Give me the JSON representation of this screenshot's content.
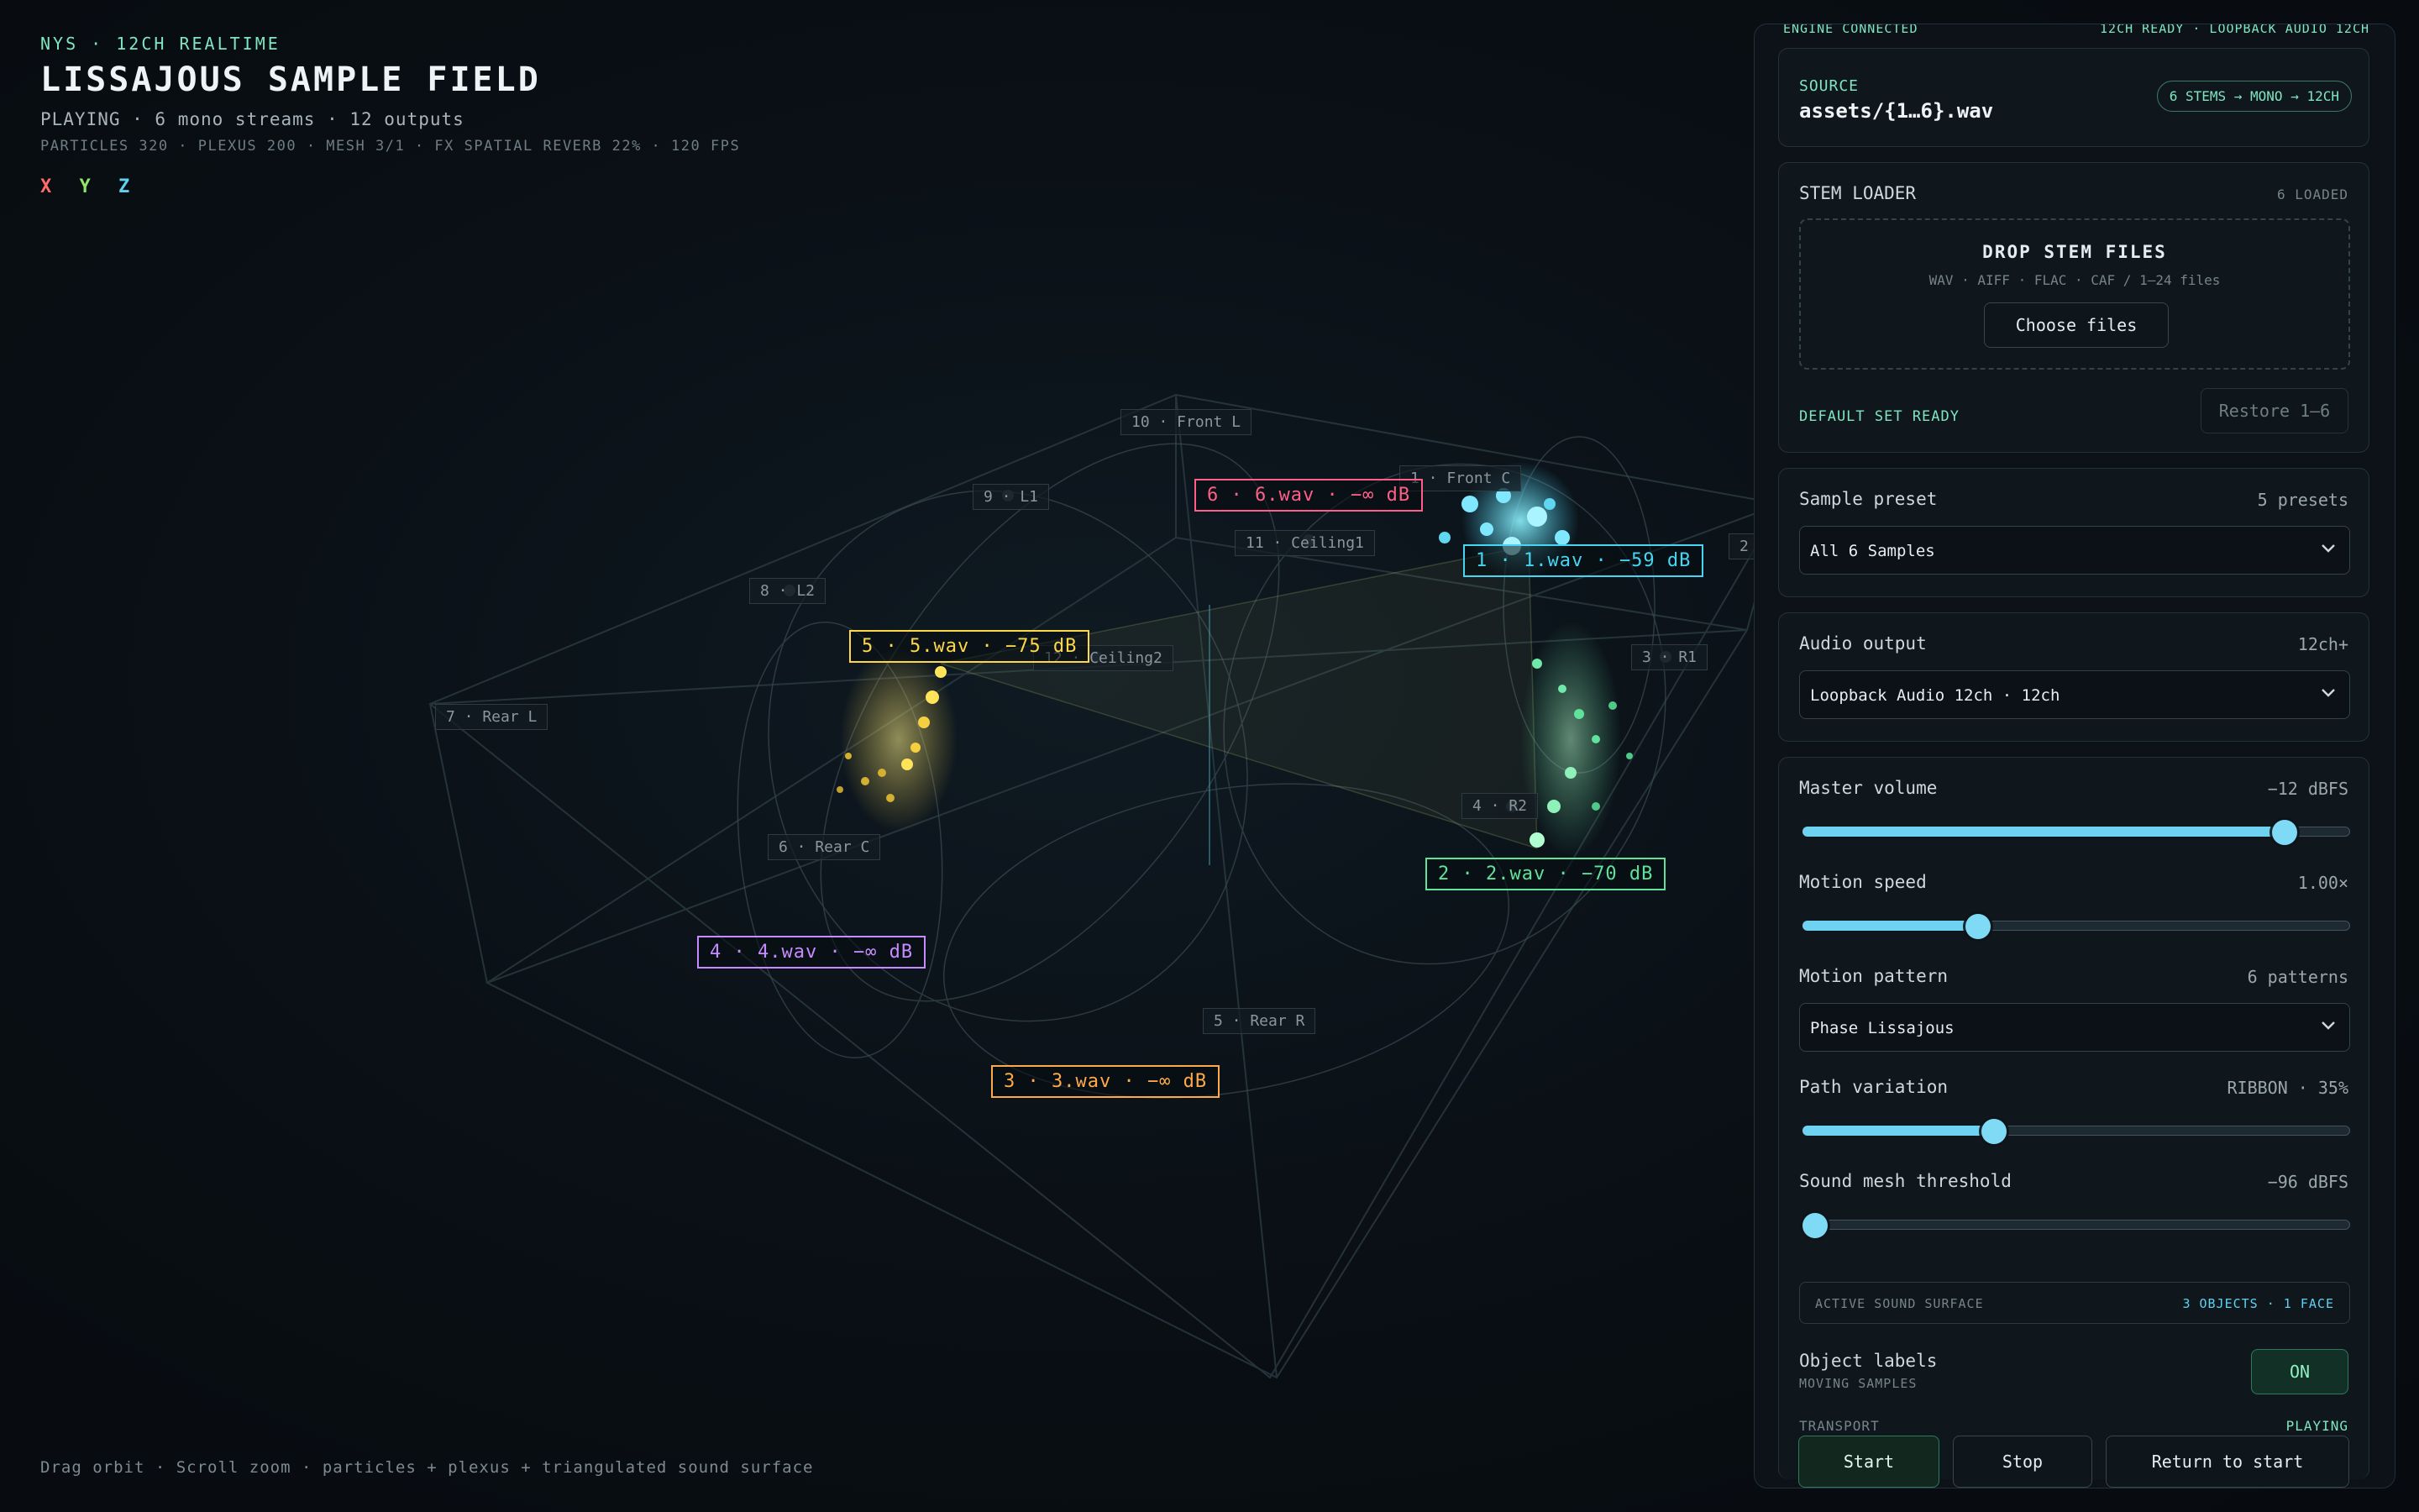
{
  "hud": {
    "kicker": "NYS · 12CH REALTIME",
    "title": "LISSAJOUS SAMPLE FIELD",
    "status": "PLAYING · 6 mono streams · 12 outputs",
    "stats": "PARTICLES 320 · PLEXUS 200 · MESH 3/1 · FX SPATIAL REVERB 22% · 120 FPS",
    "axes": [
      {
        "label": "X",
        "color": "#ff6b6b"
      },
      {
        "label": "Y",
        "color": "#8ee66b"
      },
      {
        "label": "Z",
        "color": "#5fd2f0"
      }
    ],
    "hint": "Drag orbit · Scroll zoom · particles + plexus + triangulated sound surface"
  },
  "speakers": [
    {
      "label": "10 · Front L"
    },
    {
      "label": "1 · Front C"
    },
    {
      "label": "9 · L1"
    },
    {
      "label": "11 · Ceiling1"
    },
    {
      "label": "8 · L2"
    },
    {
      "label": "12 · Ceiling2"
    },
    {
      "label": "7 · Rear L"
    },
    {
      "label": "3 · R1"
    },
    {
      "label": "4 · R2"
    },
    {
      "label": "6 · Rear C"
    },
    {
      "label": "5 · Rear R"
    },
    {
      "label": "2"
    }
  ],
  "objects": [
    {
      "label": "6 · 6.wav · −∞ dB",
      "color": "#ff5f86"
    },
    {
      "label": "1 · 1.wav · −59 dB",
      "color": "#46d6f2"
    },
    {
      "label": "5 · 5.wav · −75 dB",
      "color": "#ffd84a"
    },
    {
      "label": "2 · 2.wav · −70 dB",
      "color": "#5fe39a"
    },
    {
      "label": "4 · 4.wav · −∞ dB",
      "color": "#c68cff"
    },
    {
      "label": "3 · 3.wav · −∞ dB",
      "color": "#ffaa4a"
    }
  ],
  "panel": {
    "peek_left": "ENGINE CONNECTED",
    "peek_right": "12CH READY · LOOPBACK AUDIO 12CH",
    "source": {
      "label": "SOURCE",
      "path": "assets/{1…6}.wav",
      "badge": "6 STEMS → MONO → 12CH"
    },
    "stem_loader": {
      "title": "STEM LOADER",
      "count": "6 LOADED",
      "drop_title": "DROP STEM FILES",
      "formats": "WAV · AIFF · FLAC · CAF / 1–24 files",
      "choose": "Choose files",
      "ready": "DEFAULT SET READY",
      "restore": "Restore 1–6"
    },
    "preset": {
      "label": "Sample preset",
      "count": "5 presets",
      "selected": "All 6 Samples"
    },
    "output": {
      "label": "Audio output",
      "count": "12ch+",
      "selected": "Loopback Audio 12ch · 12ch"
    },
    "master_volume": {
      "label": "Master volume",
      "value": "−12 dBFS",
      "level": 0.88
    },
    "motion_speed": {
      "label": "Motion speed",
      "value": "1.00×",
      "level": 0.32
    },
    "motion_pattern": {
      "label": "Motion pattern",
      "count": "6 patterns",
      "selected": "Phase Lissajous"
    },
    "path_variation": {
      "label": "Path variation",
      "value": "RIBBON · 35%",
      "level": 0.35
    },
    "mesh_threshold": {
      "label": "Sound mesh threshold",
      "value": "−96 dBFS",
      "level": 0.0
    },
    "surface": {
      "label": "ACTIVE SOUND SURFACE",
      "value": "3 OBJECTS · 1 FACE"
    },
    "object_labels": {
      "label": "Object labels",
      "sub": "MOVING SAMPLES",
      "toggle": "ON"
    },
    "transport": {
      "label": "TRANSPORT",
      "state": "PLAYING",
      "start": "Start",
      "stop": "Stop",
      "rewind": "Return to start"
    }
  }
}
